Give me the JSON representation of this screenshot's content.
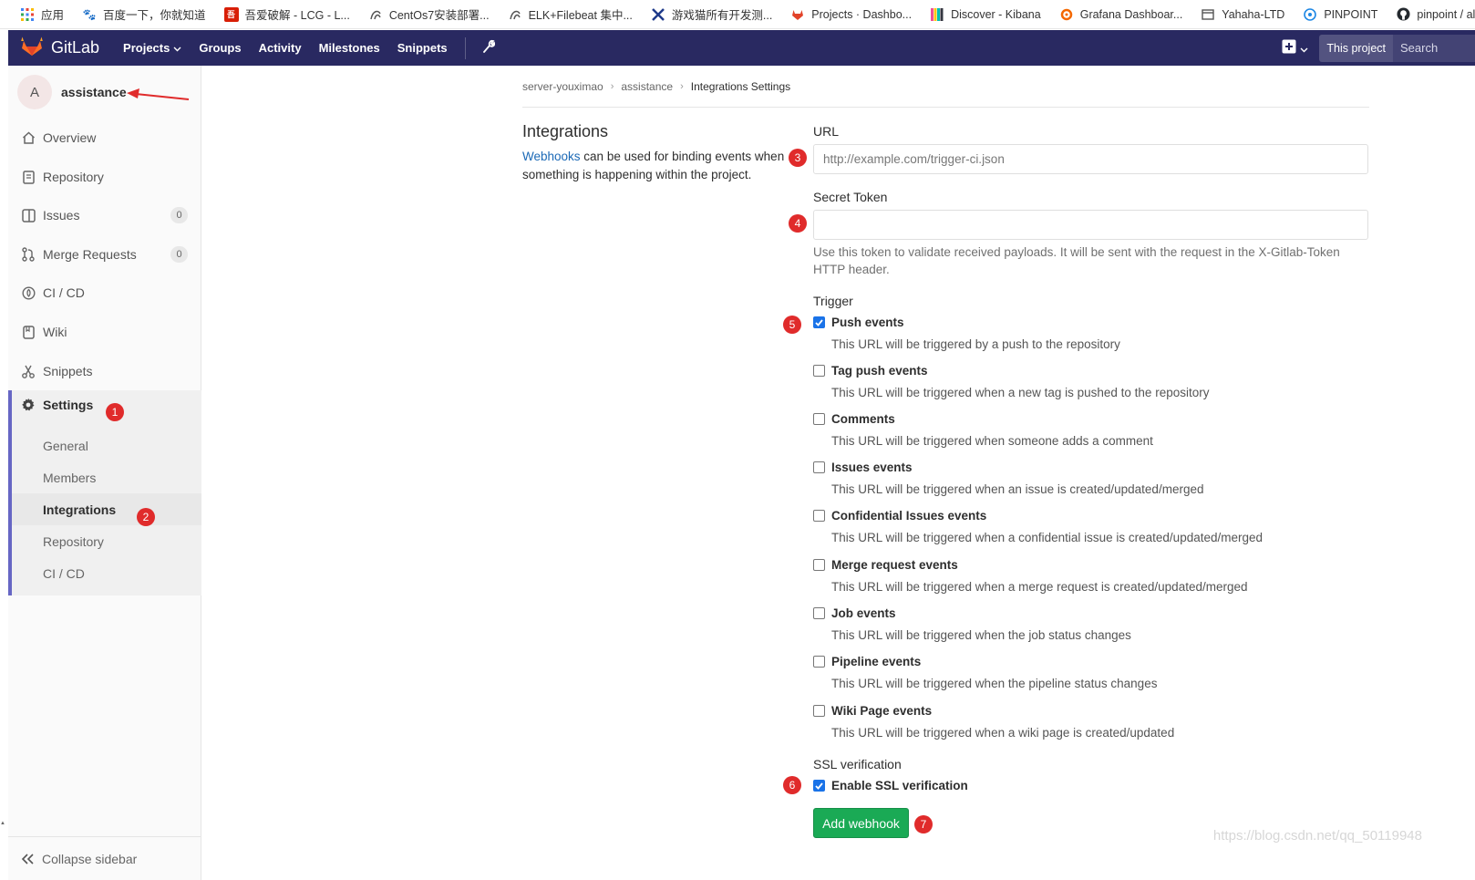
{
  "bookmarks": [
    {
      "label": "应用",
      "icon": "apps-grid-icon",
      "color": "#4285f4"
    },
    {
      "label": "百度一下，你就知道",
      "icon": "baidu-paw-icon",
      "color": "#2932e1"
    },
    {
      "label": "吾爱破解 - LCG - L...",
      "icon": "pojie-icon",
      "color": "#d81e06"
    },
    {
      "label": "CentOs7安装部署...",
      "icon": "swirl-icon",
      "color": "#555555"
    },
    {
      "label": "ELK+Filebeat 集中...",
      "icon": "swirl-icon",
      "color": "#555555"
    },
    {
      "label": "游戏猫所有开发测...",
      "icon": "x-logo-icon",
      "color": "#1e3a8a"
    },
    {
      "label": "Projects · Dashbo...",
      "icon": "gitlab-fox-icon",
      "color": "#e24329"
    },
    {
      "label": "Discover - Kibana",
      "icon": "kibana-icon",
      "color": "#f04e98"
    },
    {
      "label": "Grafana Dashboar...",
      "icon": "grafana-icon",
      "color": "#f46800"
    },
    {
      "label": "Yahaha-LTD",
      "icon": "window-icon",
      "color": "#555555"
    },
    {
      "label": "PINPOINT",
      "icon": "pinpoint-icon",
      "color": "#1e88e5"
    },
    {
      "label": "pinpoint / alarm",
      "icon": "github-icon",
      "color": "#24292e"
    }
  ],
  "header": {
    "brand": "GitLab",
    "nav": [
      "Projects",
      "Groups",
      "Activity",
      "Milestones",
      "Snippets"
    ],
    "scope": "This project",
    "search_placeholder": "Search"
  },
  "sidebar": {
    "avatar_letter": "A",
    "project": "assistance",
    "items": [
      {
        "label": "Overview",
        "icon": "home-icon"
      },
      {
        "label": "Repository",
        "icon": "doc-icon"
      },
      {
        "label": "Issues",
        "icon": "issues-icon",
        "count": "0"
      },
      {
        "label": "Merge Requests",
        "icon": "merge-icon",
        "count": "0"
      },
      {
        "label": "CI / CD",
        "icon": "rocket-icon"
      },
      {
        "label": "Wiki",
        "icon": "book-icon"
      },
      {
        "label": "Snippets",
        "icon": "scissors-icon"
      }
    ],
    "settings": {
      "label": "Settings",
      "sub": [
        "General",
        "Members",
        "Integrations",
        "Repository",
        "CI / CD"
      ]
    },
    "collapse": "Collapse sidebar"
  },
  "breadcrumb": [
    "server-youximao",
    "assistance",
    "Integrations Settings"
  ],
  "intro": {
    "title": "Integrations",
    "link": "Webhooks",
    "text": " can be used for binding events when something is happening within the project."
  },
  "form": {
    "url_label": "URL",
    "url_placeholder": "http://example.com/trigger-ci.json",
    "token_label": "Secret Token",
    "token_value": "",
    "token_help": "Use this token to validate received payloads. It will be sent with the request in the X-Gitlab-Token HTTP header.",
    "trigger_label": "Trigger",
    "triggers": [
      {
        "label": "Push events",
        "checked": true,
        "help": "This URL will be triggered by a push to the repository"
      },
      {
        "label": "Tag push events",
        "checked": false,
        "help": "This URL will be triggered when a new tag is pushed to the repository"
      },
      {
        "label": "Comments",
        "checked": false,
        "help": "This URL will be triggered when someone adds a comment"
      },
      {
        "label": "Issues events",
        "checked": false,
        "help": "This URL will be triggered when an issue is created/updated/merged"
      },
      {
        "label": "Confidential Issues events",
        "checked": false,
        "help": "This URL will be triggered when a confidential issue is created/updated/merged"
      },
      {
        "label": "Merge request events",
        "checked": false,
        "help": "This URL will be triggered when a merge request is created/updated/merged"
      },
      {
        "label": "Job events",
        "checked": false,
        "help": "This URL will be triggered when the job status changes"
      },
      {
        "label": "Pipeline events",
        "checked": false,
        "help": "This URL will be triggered when the pipeline status changes"
      },
      {
        "label": "Wiki Page events",
        "checked": false,
        "help": "This URL will be triggered when a wiki page is created/updated"
      }
    ],
    "ssl_label": "SSL verification",
    "ssl_check": "Enable SSL verification",
    "ssl_checked": true,
    "submit": "Add webhook"
  },
  "annotations": [
    "1",
    "2",
    "3",
    "4",
    "5",
    "6",
    "7"
  ],
  "watermark": "https://blog.csdn.net/qq_50119948",
  "colors": {
    "header": "#292961",
    "accent": "#6666c4",
    "primary_button": "#1aaa55",
    "link": "#1b69b6",
    "marker": "#e02b2b"
  }
}
